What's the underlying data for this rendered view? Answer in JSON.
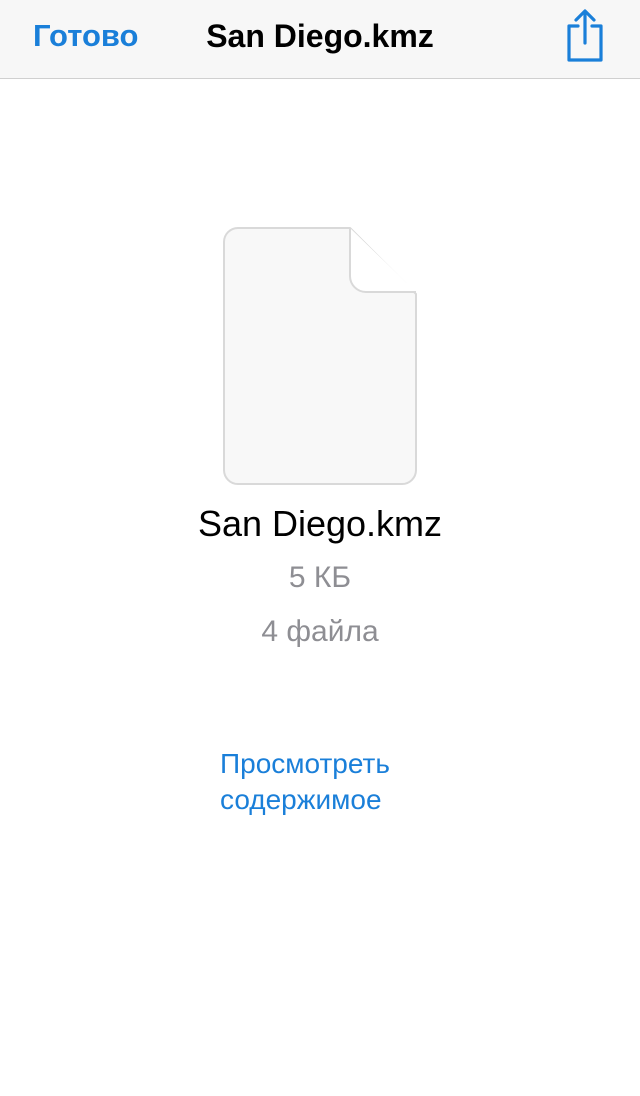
{
  "navbar": {
    "done_label": "Готово",
    "title": "San Diego.kmz",
    "share_icon": "share-icon"
  },
  "file": {
    "icon": "document-icon",
    "name": "San Diego.kmz",
    "size": "5 КБ",
    "count": "4 файла"
  },
  "actions": {
    "view_contents_line1": "Просмотреть",
    "view_contents_line2": "содержимое"
  },
  "colors": {
    "accent": "#1a7fd9",
    "secondary_text": "#8e8e93",
    "navbar_background": "#f7f7f7"
  }
}
